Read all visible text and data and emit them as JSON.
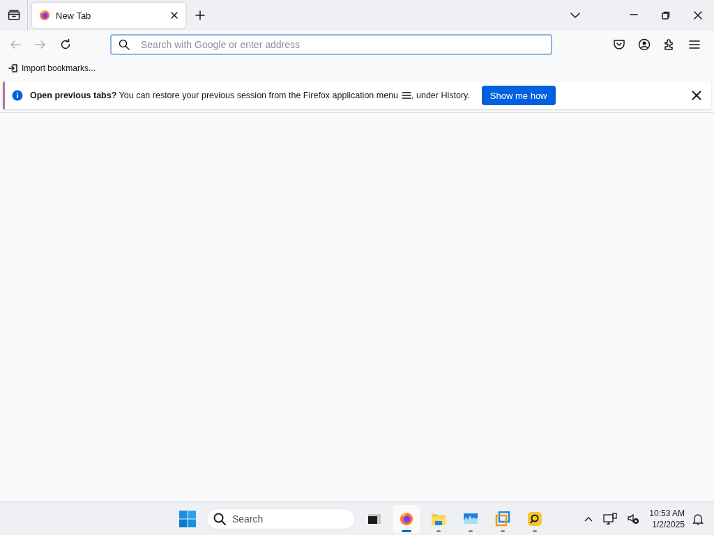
{
  "tabs": [
    {
      "title": "New Tab",
      "selected": true
    }
  ],
  "address_bar": {
    "placeholder": "Search with Google or enter address"
  },
  "bookmarks": [
    {
      "label": "Import bookmarks..."
    }
  ],
  "notification": {
    "text_before": "**Open previous tabs?** You can restore your previous session from the Firefox application menu",
    "text_after": ", under History.",
    "button": "Show me how"
  },
  "taskbar": {
    "search_placeholder": "Search",
    "apps": [
      {
        "kind": "terminal",
        "running": false,
        "active": false
      },
      {
        "kind": "firefox",
        "running": true,
        "active": true
      },
      {
        "kind": "folder",
        "running": true,
        "active": false
      },
      {
        "kind": "monitor",
        "running": true,
        "active": false
      },
      {
        "kind": "vm",
        "running": true,
        "active": false
      },
      {
        "kind": "remote",
        "running": true,
        "active": false
      }
    ],
    "time": "10:53 AM",
    "date": "1/2/2025"
  }
}
